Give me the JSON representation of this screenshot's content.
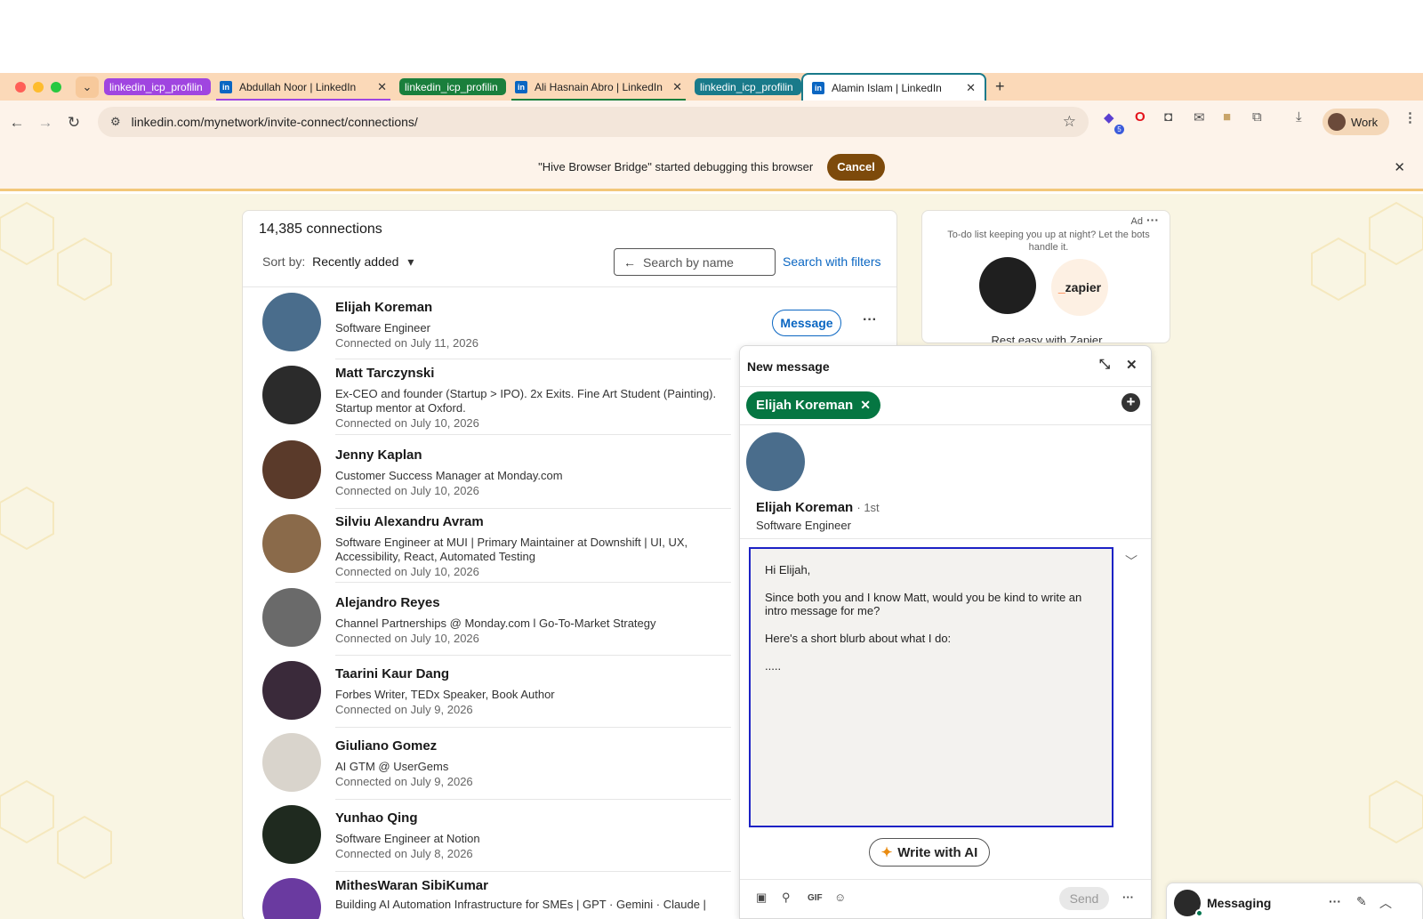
{
  "browser": {
    "tabs": [
      {
        "type": "group",
        "label": "linkedin_icp_profilin",
        "color": "#a045e0"
      },
      {
        "type": "tab",
        "title": "Abdullah Noor | LinkedIn",
        "underline": "#a045e0"
      },
      {
        "type": "group",
        "label": "linkedin_icp_profilin",
        "color": "#1a7f3c"
      },
      {
        "type": "tab",
        "title": "Ali Hasnain Abro | LinkedIn",
        "underline": "#1a7f3c"
      },
      {
        "type": "group",
        "label": "linkedin_icp_profilin",
        "color": "#197a8a"
      },
      {
        "type": "tab",
        "title": "Alamin Islam | LinkedIn",
        "active": true
      }
    ],
    "url": "linkedin.com/mynetwork/invite-connect/connections/",
    "profile_label": "Work",
    "extension_badge": "5",
    "debug_banner": {
      "message": "\"Hive Browser Bridge\" started debugging this browser",
      "cancel_label": "Cancel"
    }
  },
  "connections": {
    "count_label": "14,385 connections",
    "sort_label": "Sort by:",
    "sort_value": "Recently added",
    "search_placeholder": "Search by name",
    "search_filters_label": "Search with filters",
    "message_button": "Message",
    "items": [
      {
        "name": "Elijah Koreman",
        "headline": "Software Engineer",
        "since": "Connected on July 11, 2026",
        "color": "#4a6d8c"
      },
      {
        "name": "Matt Tarczynski",
        "headline": "Ex-CEO and founder (Startup > IPO). 2x Exits. Fine Art Student (Painting). Startup mentor at Oxford.",
        "since": "Connected on July 10, 2026",
        "color": "#2b2b2b"
      },
      {
        "name": "Jenny Kaplan",
        "headline": "Customer Success Manager at Monday.com",
        "since": "Connected on July 10, 2026",
        "color": "#5a3a2a"
      },
      {
        "name": "Silviu Alexandru Avram",
        "headline": "Software Engineer at MUI | Primary Maintainer at Downshift | UI, UX, Accessibility, React, Automated Testing",
        "since": "Connected on July 10, 2026",
        "color": "#8a6a4a"
      },
      {
        "name": "Alejandro Reyes",
        "headline": "Channel Partnerships @ Monday.com l Go-To-Market Strategy",
        "since": "Connected on July 10, 2026",
        "color": "#6a6a6a"
      },
      {
        "name": "Taarini Kaur Dang",
        "headline": "Forbes Writer, TEDx Speaker, Book Author",
        "since": "Connected on July 9, 2026",
        "color": "#3a2a3a"
      },
      {
        "name": "Giuliano Gomez",
        "headline": "AI GTM @ UserGems",
        "since": "Connected on July 9, 2026",
        "color": "#d9d4cc"
      },
      {
        "name": "Yunhao Qing",
        "headline": "Software Engineer at Notion",
        "since": "Connected on July 8, 2026",
        "color": "#1f2a1f"
      },
      {
        "name": "MithesWaran SibiKumar",
        "headline": "Building AI Automation Infrastructure for SMEs | GPT · Gemini · Claude |",
        "since": "",
        "color": "#6a3aa0"
      }
    ]
  },
  "ad": {
    "label": "Ad",
    "text": "To-do list keeping you up at night? Let the bots handle it.",
    "brand": "zapier",
    "tagline": "Rest easy with Zapier"
  },
  "compose": {
    "title": "New message",
    "recipient": "Elijah Koreman",
    "profile_name": "Elijah Koreman",
    "degree": "· 1st",
    "profile_headline": "Software Engineer",
    "body": {
      "line1": "Hi Elijah,",
      "line2": "Since both you and I know Matt, would you be kind to write an intro message for me?",
      "line3": "Here's a short blurb about what I do:",
      "line4": "....."
    },
    "ai_button": "Write with AI",
    "send_label": "Send",
    "gif_label": "GIF"
  },
  "messaging": {
    "label": "Messaging"
  },
  "colors": {
    "linkedin_blue": "#0a66c2",
    "pill_green": "#057642",
    "focus_border": "#1c22c5",
    "cancel_brown": "#7d4a0b"
  }
}
